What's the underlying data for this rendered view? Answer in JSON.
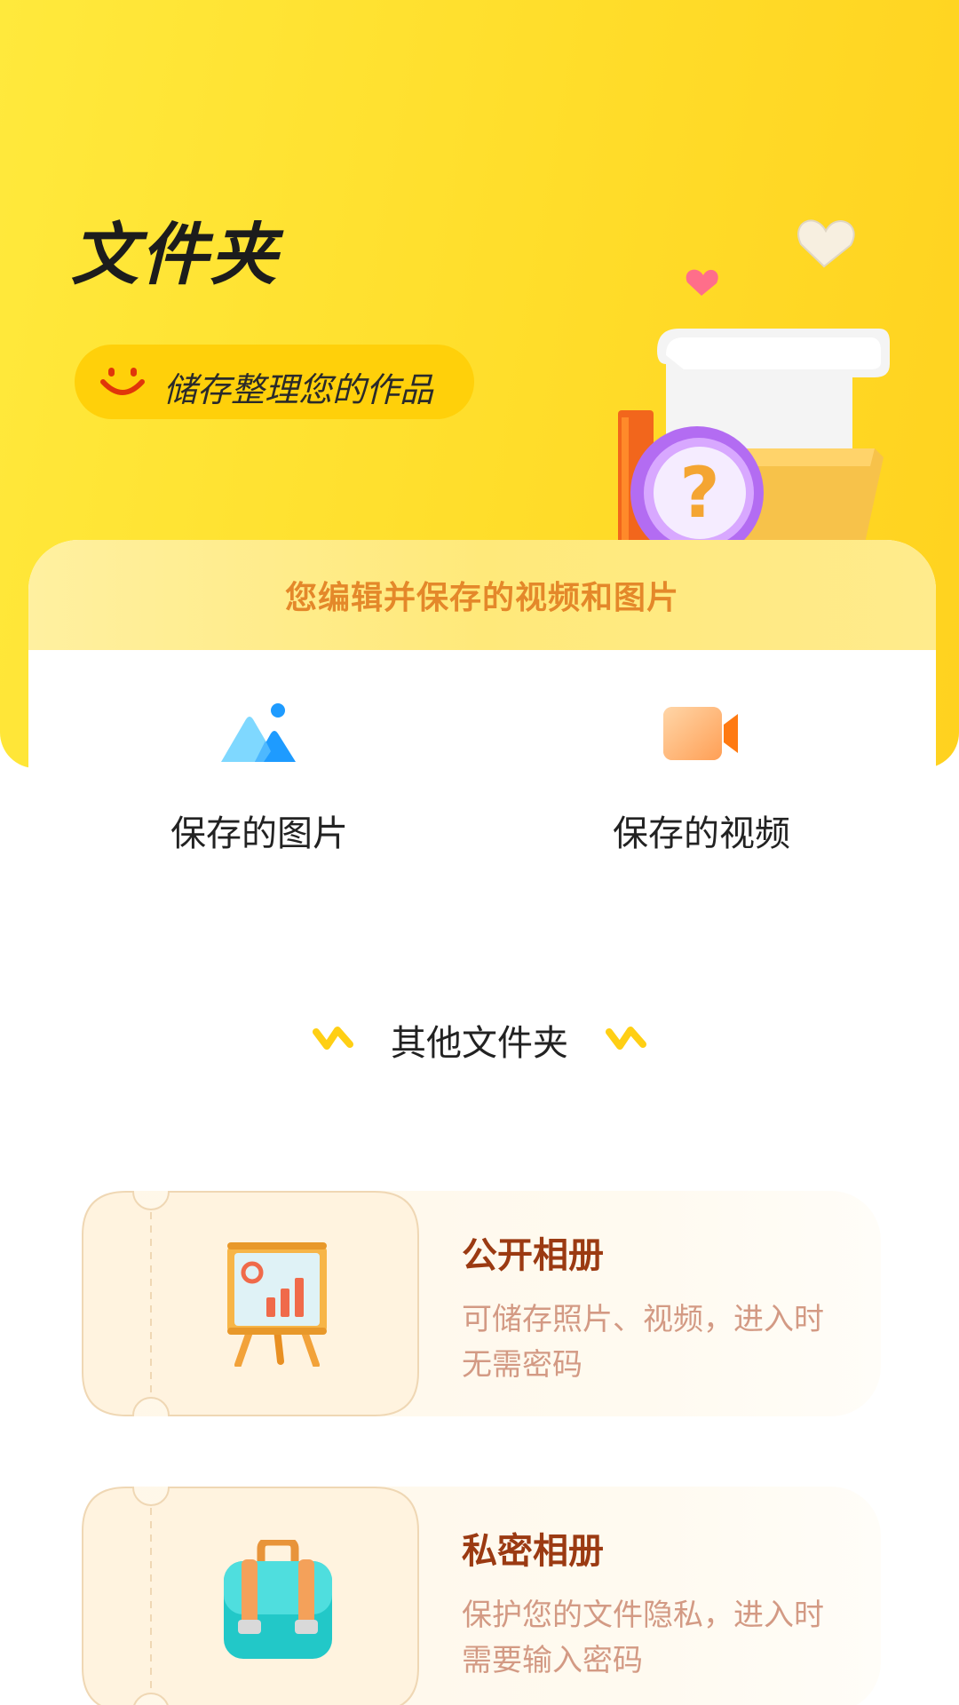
{
  "header": {
    "title": "文件夹",
    "subtitle": "储存整理您的作品"
  },
  "saved_card": {
    "banner": "您编辑并保存的视频和图片",
    "tiles": [
      {
        "label": "保存的图片",
        "icon": "image-icon"
      },
      {
        "label": "保存的视频",
        "icon": "video-icon"
      }
    ]
  },
  "other_section": {
    "title": "其他文件夹"
  },
  "folders": [
    {
      "title": "公开相册",
      "description": "可储存照片、视频，进入时无需密码",
      "icon": "presentation-board-icon"
    },
    {
      "title": "私密相册",
      "description": "保护您的文件隐私，进入时需要输入密码",
      "icon": "briefcase-icon"
    }
  ],
  "colors": {
    "primary_yellow": "#ffdd2a",
    "accent_orange": "#e4882a",
    "folder_title": "#9b3a12",
    "folder_desc": "#d39a84"
  }
}
